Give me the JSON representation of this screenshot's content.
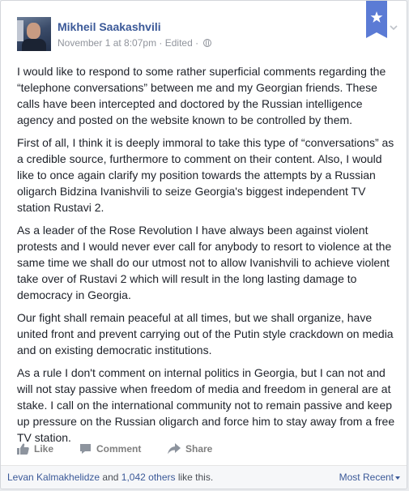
{
  "post": {
    "author": "Mikheil Saakashvili",
    "timestamp": "November 1 at 8:07pm",
    "separator": " · ",
    "edited": "Edited",
    "separator2": " · ",
    "paragraphs": [
      "I would like to respond to some rather superficial comments regarding the “telephone conversations” between me and my Georgian friends. These calls have been intercepted and doctored by the Russian intelligence agency and posted on the website known to be controlled by them.",
      "First of all, I think it is deeply immoral to take this type of “conversations” as a credible source, furthermore to comment on their content. Also, I would like to once again clarify my position towards the attempts by a Russian oligarch Bidzina Ivanishvili to seize Georgia's biggest independent TV station Rustavi 2.",
      "As a leader of the Rose Revolution I have always been against violent protests and I would never ever call for anybody to resort to violence at the same time we shall do our utmost not to allow Ivanishvili to achieve violent take over of Rustavi 2 which will result in the long lasting damage to democracy in Georgia.",
      "Our fight shall remain peaceful at all times, but we shall organize, have united front and prevent carrying out of the Putin style crackdown on media and on existing democratic institutions.",
      "As a rule I don't comment on internal politics in Georgia, but I can not and will not stay passive when freedom of media and freedom in general are at stake. I call on the international community not to remain passive and keep up pressure on the Russian oligarch and force him to stay away from a free TV station."
    ]
  },
  "actions": {
    "like": "Like",
    "comment": "Comment",
    "share": "Share"
  },
  "footer": {
    "liker": "Levan Kalmakhelidze",
    "and": " and ",
    "others": "1,042 others",
    "like_this": " like this.",
    "sort": "Most Recent"
  },
  "icons": {
    "privacy": "globe-icon",
    "ribbon": "star-ribbon-icon",
    "menu": "chevron-down-icon",
    "like": "thumbs-up-icon",
    "comment": "speech-bubble-icon",
    "share": "share-arrow-icon"
  },
  "colors": {
    "link": "#3b5998",
    "ribbon": "#5b7bd5",
    "text": "#1d2129",
    "meta": "#90949c",
    "footer_bg": "#f6f7f9"
  }
}
